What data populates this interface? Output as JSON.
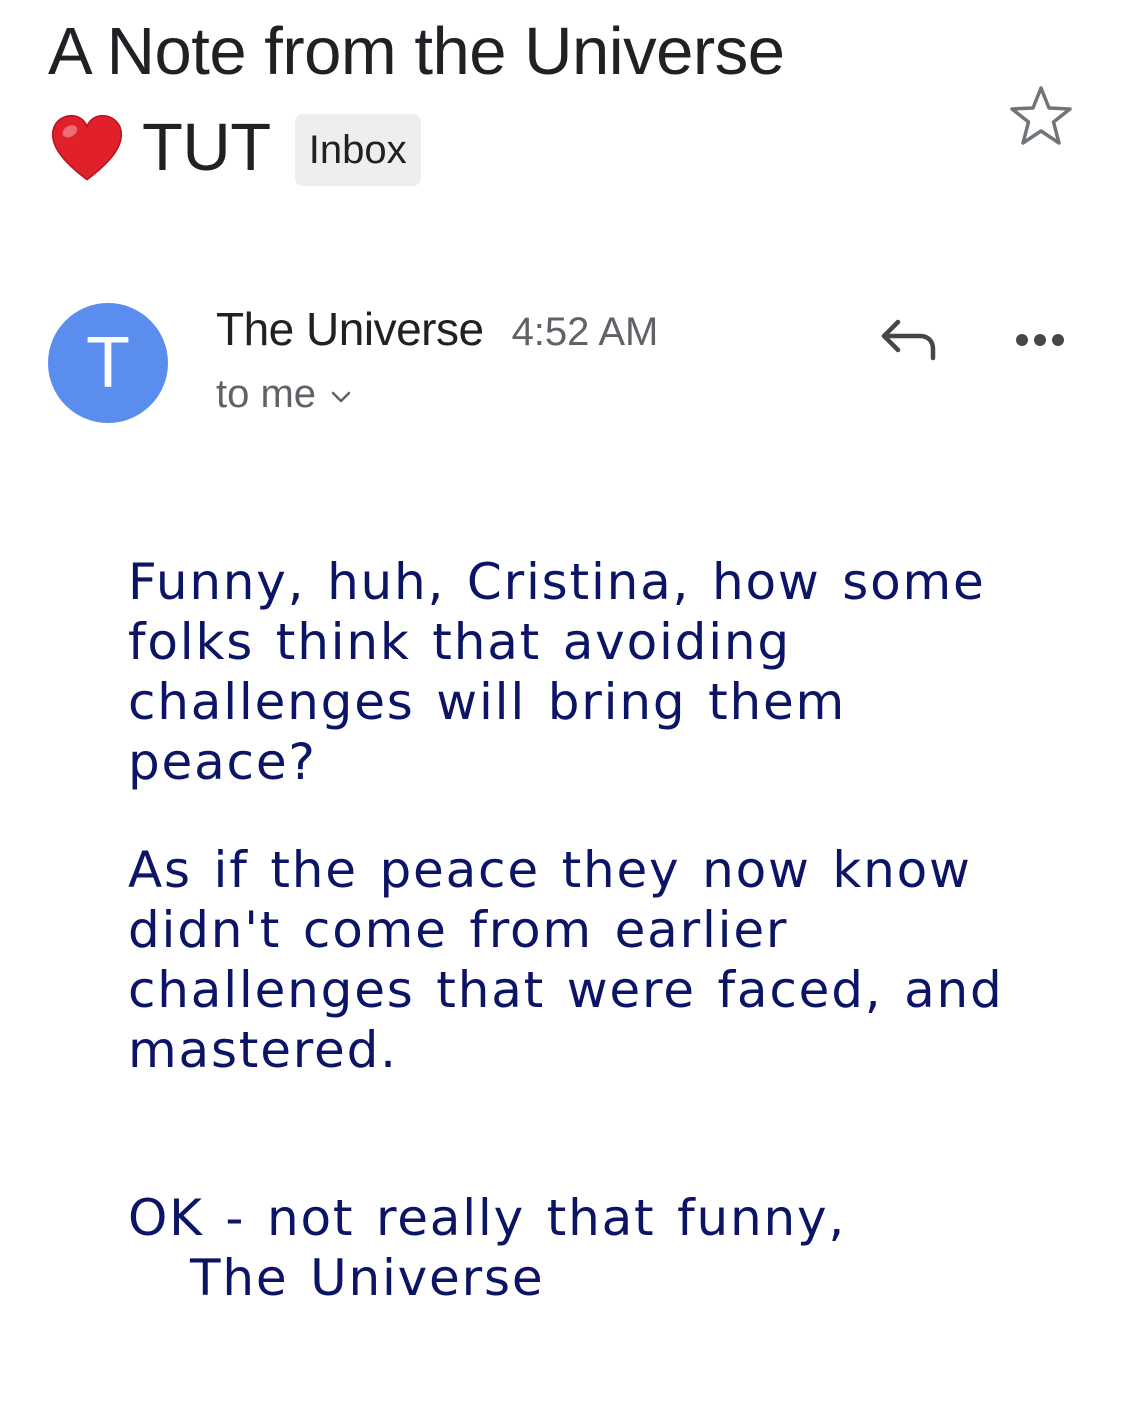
{
  "email": {
    "subject_line1": "A Note from the Universe",
    "subject_line2": "TUT",
    "subject_emoji": "red-heart",
    "label_chip": "Inbox",
    "sender": {
      "avatar_letter": "T",
      "name": "The Universe",
      "time": "4:52 AM",
      "recipient": "to me"
    },
    "body": {
      "paragraph1": "Funny, huh, Cristina, how some\nfolks think that avoiding\nchallenges will bring them\npeace?",
      "paragraph2": "As if the peace they now know\ndidn't come from earlier\nchallenges that were faced, and\nmastered.",
      "closing": "OK - not really that funny,",
      "signature": "The Universe"
    }
  },
  "icons": {
    "star": "star-outline-icon",
    "reply": "reply-arrow-icon",
    "more": "more-horizontal-icon",
    "chevron": "chevron-down-icon",
    "heart": "red-heart-icon"
  },
  "colors": {
    "avatar_bg": "#5b8def",
    "body_text": "#0c1466",
    "secondary_text": "#5f6368",
    "chip_bg": "#eeeeee",
    "heart": "#e0202b"
  }
}
